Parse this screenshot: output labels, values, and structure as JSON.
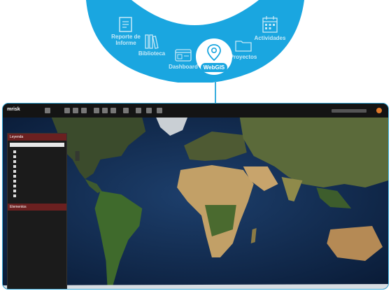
{
  "menu": {
    "items": [
      {
        "label_lines": [
          "Reporte de",
          "Informe"
        ],
        "icon": "report-icon"
      },
      {
        "label_lines": [
          "Biblioteca"
        ],
        "icon": "books-icon"
      },
      {
        "label_lines": [
          "Dashboard"
        ],
        "icon": "dashboard-icon"
      },
      {
        "label_lines": [
          "WebGIS"
        ],
        "icon": "map-pin-icon",
        "active": true
      },
      {
        "label_lines": [
          "Proyectos"
        ],
        "icon": "folder-icon"
      },
      {
        "label_lines": [
          "Actividades"
        ],
        "icon": "calendar-icon"
      }
    ],
    "colors": {
      "arc": "#1aa6e0",
      "active": "#ffffff",
      "frame": "#39aede"
    }
  },
  "app": {
    "logo": "mrisk",
    "panel": {
      "legend_title": "Leyenda",
      "elements_title": "Elementos"
    }
  }
}
